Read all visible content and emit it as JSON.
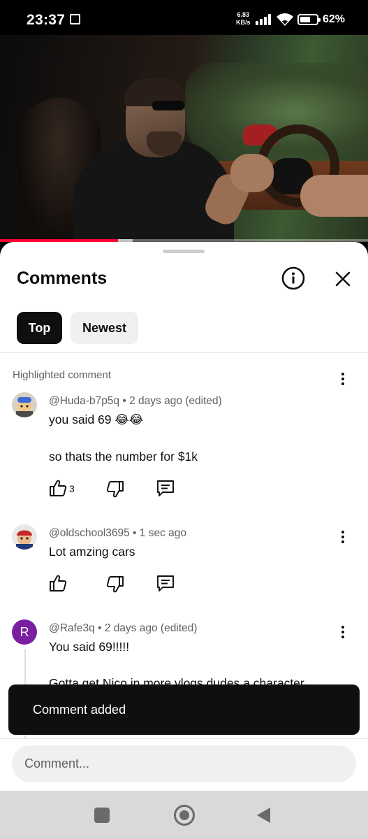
{
  "status_bar": {
    "time": "23:37",
    "net_speed_value": "6.83",
    "net_speed_unit": "KB/s",
    "battery_percent": "62%",
    "battery_level": 0.62
  },
  "video": {
    "progress_played": 0.32,
    "progress_buffered": 0.36
  },
  "comments_sheet": {
    "title": "Comments",
    "filters": [
      {
        "label": "Top",
        "selected": true
      },
      {
        "label": "Newest",
        "selected": false
      }
    ],
    "highlighted_label": "Highlighted comment",
    "comments": [
      {
        "author": "@Huda-b7p5q",
        "meta_sep": " • ",
        "time": "2 days ago (edited)",
        "line1": "you said 69   😂😂",
        "line2": "so thats the number for $1k",
        "like_count": "3"
      },
      {
        "author": "@oldschool3695",
        "meta_sep": " • ",
        "time": "1 sec ago",
        "line1": "Lot amzing cars"
      },
      {
        "author": "@Rafe3q",
        "meta_sep": " • ",
        "time": "2 days ago (edited)",
        "avatar_letter": "R",
        "line1": "You said 69!!!!!",
        "line2": "Gotta get Nico in more vlogs dudes a character"
      }
    ],
    "toast": "Comment added",
    "input_placeholder": "Comment..."
  },
  "colors": {
    "accent_red": "#ff0033",
    "rafe_avatar": "#7b1fa2",
    "chip_selected_bg": "#0f0f0f",
    "chip_bg": "#f0f0f0"
  }
}
